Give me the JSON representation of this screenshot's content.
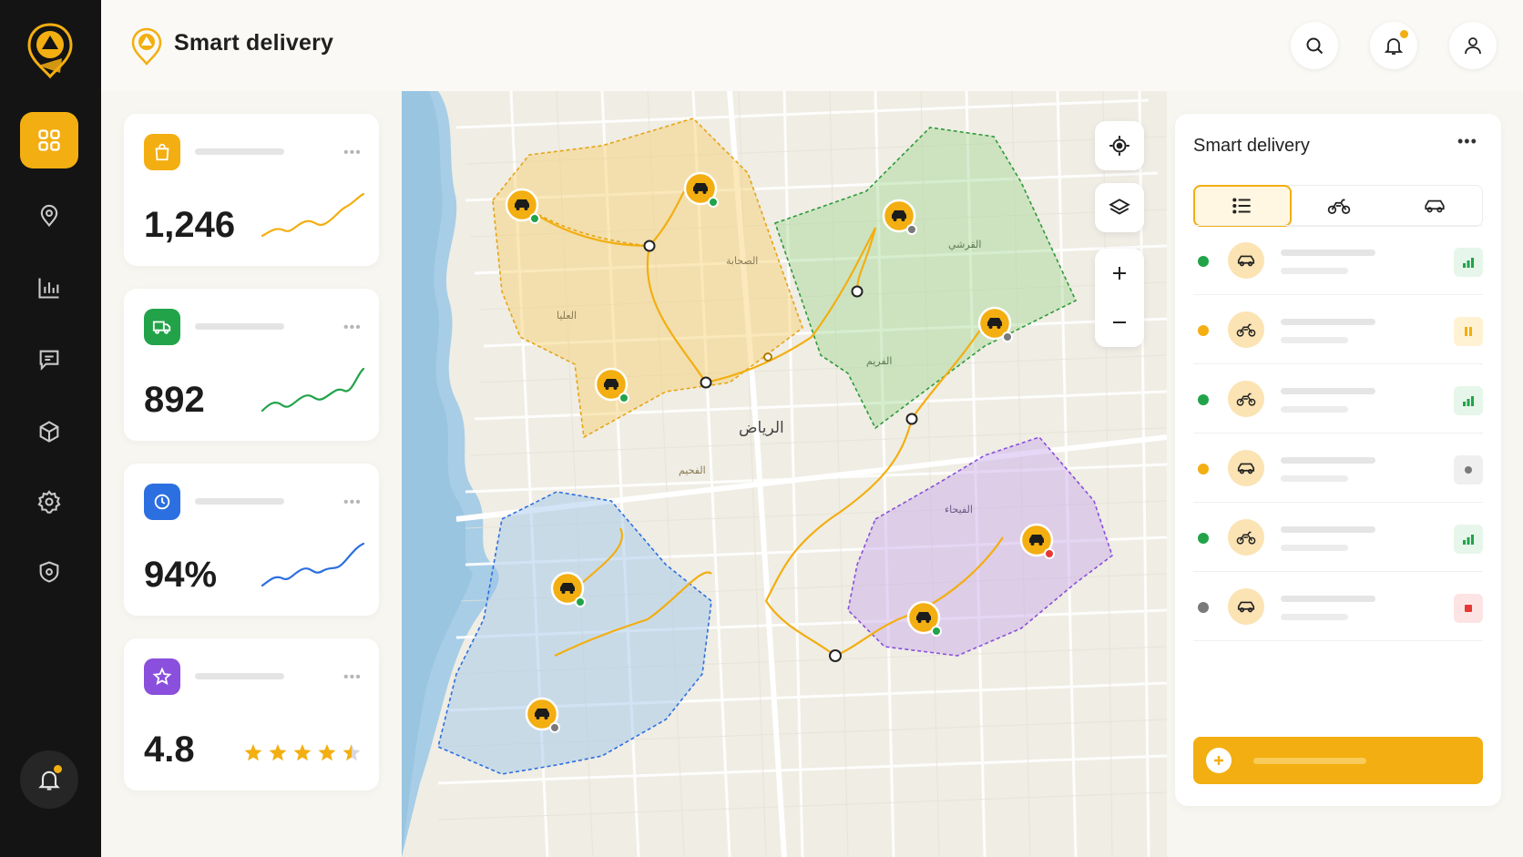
{
  "app": {
    "title": "Smart delivery"
  },
  "colors": {
    "accent": "#f3ae11",
    "sidebar": "#141414",
    "green": "#22a34a",
    "blue": "#2c6fe0",
    "purple": "#8a4fdc",
    "red": "#e53935",
    "gray": "#7a7a7a"
  },
  "sidebar": {
    "items": [
      {
        "icon": "dashboard-grid-icon",
        "active": true
      },
      {
        "icon": "location-pin-icon",
        "active": false
      },
      {
        "icon": "analytics-chart-icon",
        "active": false
      },
      {
        "icon": "messages-icon",
        "active": false
      },
      {
        "icon": "package-box-icon",
        "active": false
      },
      {
        "icon": "settings-gear-icon",
        "active": false
      },
      {
        "icon": "shield-icon",
        "active": false
      }
    ],
    "bottom_icon": "notification-bell-icon"
  },
  "header": {
    "icons": [
      "search-icon",
      "notification-bell-icon",
      "user-profile-icon"
    ]
  },
  "stats": [
    {
      "icon": "shopping-bag-icon",
      "value": "1,246",
      "color": "#f3ae11"
    },
    {
      "icon": "delivery-truck-icon",
      "value": "892",
      "color": "#22a34a"
    },
    {
      "icon": "clock-icon",
      "value": "94%",
      "color": "#2c6fe0"
    },
    {
      "icon": "star-icon",
      "value": "4.8",
      "color": "#8a4fdc",
      "rating": 4.5
    }
  ],
  "map": {
    "city_label": "الرياض",
    "district_labels": [
      "الصحابة",
      "العليا",
      "القرشي",
      "الفريم",
      "الفيحاء",
      "الفحيم"
    ],
    "controls": [
      "locate-me-icon",
      "layers-icon",
      "zoom-in-icon",
      "zoom-out-icon"
    ]
  },
  "panel": {
    "title": "Smart delivery",
    "tabs": [
      {
        "icon": "list-icon",
        "active": true
      },
      {
        "icon": "motorbike-icon",
        "active": false
      },
      {
        "icon": "car-icon",
        "active": false
      }
    ],
    "rows": [
      {
        "vehicle": "car-icon",
        "status": "green",
        "badge": "signal-bars-icon"
      },
      {
        "vehicle": "motorbike-icon",
        "status": "orange",
        "badge": "pause-icon"
      },
      {
        "vehicle": "motorbike-icon",
        "status": "green",
        "badge": "signal-bars-icon"
      },
      {
        "vehicle": "car-icon",
        "status": "orange",
        "badge": "offline-dot-icon"
      },
      {
        "vehicle": "motorbike-icon",
        "status": "green",
        "badge": "signal-bars-icon"
      },
      {
        "vehicle": "car-icon",
        "status": "gray",
        "badge": "stop-icon"
      }
    ]
  }
}
